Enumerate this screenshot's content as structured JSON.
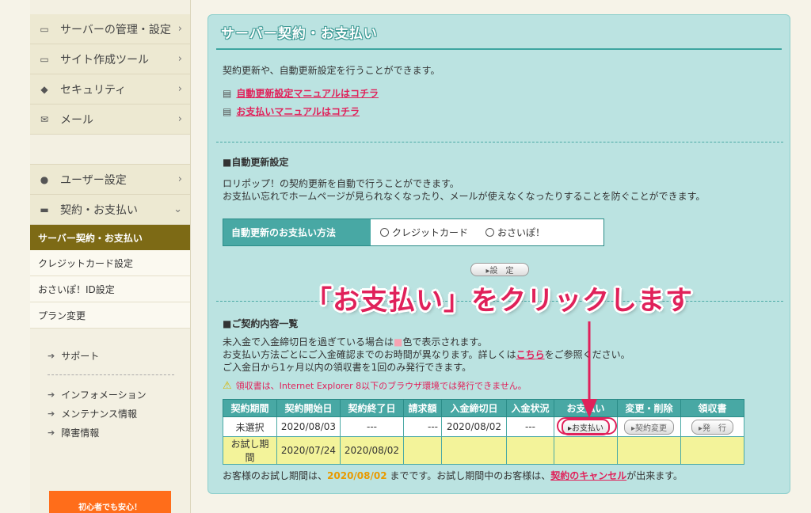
{
  "sidebar": {
    "items": [
      {
        "label": "サーバーの管理・設定",
        "icon": "server-icon",
        "chev": "›"
      },
      {
        "label": "サイト作成ツール",
        "icon": "laptop-icon",
        "chev": "›"
      },
      {
        "label": "セキュリティ",
        "icon": "shield-icon",
        "chev": "›"
      },
      {
        "label": "メール",
        "icon": "mail-icon",
        "chev": "›"
      }
    ],
    "user_items": [
      {
        "label": "ユーザー設定",
        "icon": "user-icon",
        "chev": "›"
      },
      {
        "label": "契約・お支払い",
        "icon": "card-icon",
        "chev": "⌄"
      }
    ],
    "sub_active": "サーバー契約・お支払い",
    "sub_items": [
      "クレジットカード設定",
      "おさいぽ！ID設定",
      "プラン変更"
    ],
    "links_top": [
      "サポート"
    ],
    "links_bottom": [
      "インフォメーション",
      "メンテナンス情報",
      "障害情報"
    ],
    "banner": "初心者でも安心！"
  },
  "panel": {
    "title": "サーバー契約・お支払い",
    "intro": "契約更新や、自動更新設定を行うことができます。",
    "link_auto_manual": "自動更新設定マニュアルはコチラ",
    "link_pay_manual": "お支払いマニュアルはコチラ",
    "auto_heading": "■自動更新設定",
    "auto_desc1": "ロリポップ！の契約更新を自動で行うことができます。",
    "auto_desc2": "お支払い忘れでホームページが見られなくなったり、メールが使えなくなったりすることを防ぐことができます。",
    "auto_method_label": "自動更新のお支払い方法",
    "auto_option1": "クレジットカード",
    "auto_option2": "おさいぽ！",
    "set_button": "▸設　定",
    "contract_heading": "■ご契約内容一覧",
    "note1a": "未入金で入金締切日を過ぎている場合は",
    "note1b": "■",
    "note1c": "色で表示されます。",
    "note2a": "お支払い方法ごとにご入金確認までのお時間が異なります。詳しくは",
    "note2_link": "こちら",
    "note2b": "をご参照ください。",
    "note3": "ご入金日から1ヶ月以内の領収書を1回のみ発行できます。",
    "warning": "領収書は、Internet Explorer 8以下のブラウザ環境では発行できません。",
    "table": {
      "headers": [
        "契約期間",
        "契約開始日",
        "契約終了日",
        "請求額",
        "入金締切日",
        "入金状況",
        "お支払い",
        "変更・削除",
        "領収書"
      ],
      "row1": [
        "未選択",
        "2020/08/03",
        "---",
        "---",
        "2020/08/02",
        "---"
      ],
      "pay_button": "▸お支払い",
      "change_button": "▸契約変更",
      "receipt_button": "▸発　行",
      "row2": [
        "お試し期間",
        "2020/07/24",
        "2020/08/02"
      ]
    },
    "bottom_a": "お客様のお試し期間は、",
    "bottom_date": "2020/08/02",
    "bottom_b": "までです。お試し期間中のお客様は、",
    "bottom_link": "契約のキャンセル",
    "bottom_c": "が出来ます。"
  },
  "annotation": {
    "callout": "「お支払い」をクリックします",
    "color": "#e0215a"
  }
}
